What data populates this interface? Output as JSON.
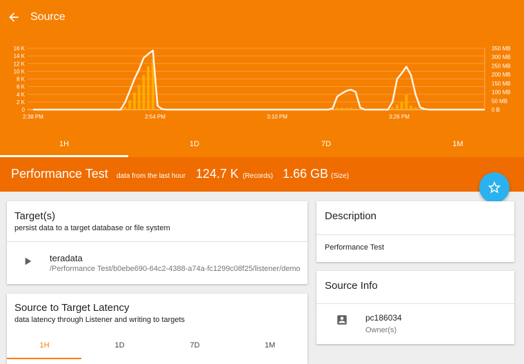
{
  "appbar": {
    "title": "Source",
    "back_icon": "arrow-back-icon"
  },
  "colors": {
    "header": "#f57f00",
    "perf_bar": "#ef6c00",
    "fab": "#2bb2ee",
    "accent": "#f57f00"
  },
  "chart_data": {
    "type": "line",
    "y_left_ticks": [
      "16 K",
      "14 K",
      "12 K",
      "10 K",
      "8 K",
      "6 K",
      "4 K",
      "2 K",
      "0"
    ],
    "y_right_ticks": [
      "350 MB",
      "300 MB",
      "250 MB",
      "200 MB",
      "150 MB",
      "100 MB",
      "50 MB",
      "0 B"
    ],
    "x_ticks": [
      "2:38 PM",
      "2:54 PM",
      "3:10 PM",
      "3:26 PM"
    ],
    "ylim_left": [
      0,
      16000
    ],
    "ylim_right": [
      0,
      350
    ],
    "series": [
      {
        "values": [
          0,
          0,
          0,
          0,
          0,
          0,
          0,
          0,
          0,
          0,
          0,
          0,
          0,
          0,
          0,
          0,
          0,
          0,
          0,
          0,
          2000,
          5000,
          8000,
          10500,
          13500,
          14500,
          15400,
          1000,
          100,
          0,
          0,
          0,
          0,
          0,
          0,
          0,
          0,
          0,
          0,
          0,
          0,
          0,
          0,
          0,
          0,
          0,
          0,
          0,
          0,
          0,
          0,
          0,
          0,
          0,
          0,
          0,
          0,
          0,
          0,
          0,
          0,
          0,
          0,
          0,
          0,
          300,
          3400,
          4200,
          4900,
          5200,
          4600,
          500,
          0,
          0,
          0,
          0,
          0,
          0,
          2000,
          8000,
          9500,
          11200,
          9000,
          4000,
          600,
          100,
          0,
          0,
          0,
          0,
          0,
          0,
          0,
          0,
          0,
          0,
          0,
          0,
          0
        ]
      },
      {
        "values": [
          0,
          0,
          0,
          0,
          0,
          0,
          0,
          0,
          0,
          0,
          0,
          0,
          0,
          0,
          0,
          0,
          0,
          0,
          0,
          0,
          700,
          2500,
          4500,
          6500,
          9000,
          11300,
          13000,
          0,
          0,
          0,
          0,
          0,
          0,
          0,
          0,
          0,
          0,
          0,
          0,
          0,
          0,
          0,
          0,
          0,
          0,
          0,
          0,
          0,
          0,
          0,
          0,
          0,
          0,
          0,
          0,
          0,
          0,
          0,
          0,
          0,
          0,
          0,
          0,
          0,
          0,
          0,
          500,
          500,
          500,
          500,
          300,
          0,
          0,
          0,
          0,
          0,
          0,
          0,
          600,
          1300,
          2000,
          3900,
          1000,
          500,
          0,
          0,
          0,
          0,
          0,
          0,
          0,
          0,
          0,
          0,
          0,
          0,
          0,
          0,
          0
        ]
      }
    ]
  },
  "time_tabs": [
    "1H",
    "1D",
    "7D",
    "1M"
  ],
  "perf": {
    "name": "Performance Test",
    "sub": "data from the last hour",
    "records": "124.7 K",
    "records_label": "(Records)",
    "size": "1.66 GB",
    "size_label": "(Size)"
  },
  "targets_card": {
    "title": "Target(s)",
    "subtitle": "persist data to a target database or file system",
    "item_name": "teradata",
    "item_path": "/Performance Test/b0ebe690-64c2-4388-a74a-fc1299c08f25/listener/demo",
    "item_icon": "play-icon"
  },
  "latency_card": {
    "title": "Source to Target Latency",
    "subtitle": "data latency through Listener and writing to targets",
    "tabs": [
      "1H",
      "1D",
      "7D",
      "1M"
    ]
  },
  "description_card": {
    "title": "Description",
    "text": "Performance Test"
  },
  "source_info_card": {
    "title": "Source Info",
    "owner": "pc186034",
    "owner_label": "Owner(s)",
    "icon": "account-box-icon"
  }
}
